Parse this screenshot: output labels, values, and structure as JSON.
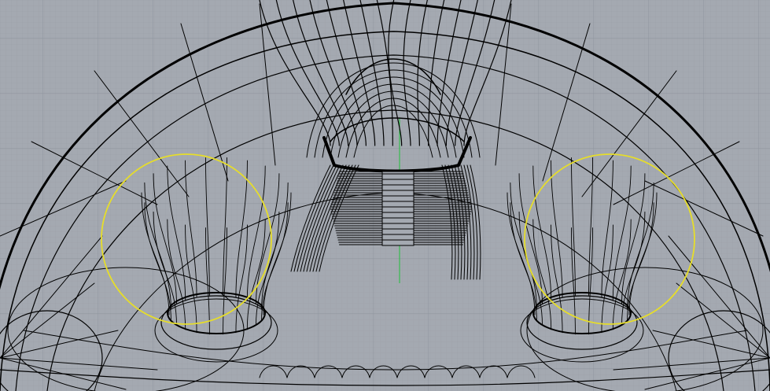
{
  "viewport": {
    "projection": "top",
    "background_color": "#a4a9b1",
    "grid_minor_color": "#9aa0a8",
    "grid_major_color": "#8f959e",
    "axis_y_color": "#1fbf3a",
    "curve_color": "#000000",
    "selection_color": "#e6dd2a"
  },
  "selection": {
    "count": 2,
    "highlight": "yellow"
  }
}
